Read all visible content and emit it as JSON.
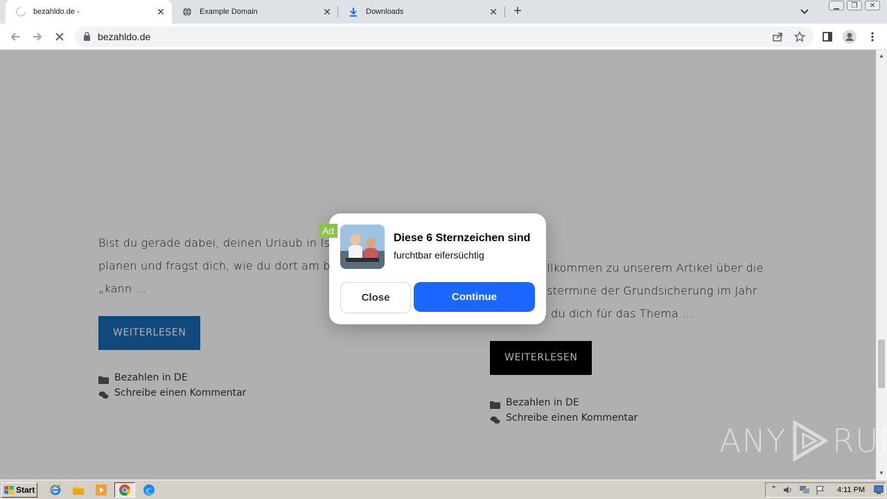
{
  "browser": {
    "tabs": [
      {
        "title": "bezahldo.de -",
        "active": true
      },
      {
        "title": "Example Domain",
        "active": false
      },
      {
        "title": "Downloads",
        "active": false
      }
    ],
    "url": "bezahldo.de"
  },
  "page": {
    "left_post": {
      "excerpt_lines": [
        "Bist du gerade dabei, deinen Urlaub in Islan",
        "planen und fragst dich, wie du dort am bes",
        "„kann …"
      ],
      "button": "WEITERLESEN",
      "category": "Bezahlen in DE",
      "comment": "Schreibe einen Kommentar"
    },
    "right_post": {
      "excerpt_lines": [
        "Willkommen zu unserem Artikel über die",
        "ngstermine der Grundsicherung im Jahr",
        "nn du dich für das Thema …"
      ],
      "button": "WEITERLESEN",
      "category": "Bezahlen in DE",
      "comment": "Schreibe einen Kommentar"
    }
  },
  "ad_modal": {
    "badge": "Ad",
    "title": "Diese 6 Sternzeichen sind",
    "subtitle": "furchtbar eifersüchtig",
    "close_label": "Close",
    "continue_label": "Continue"
  },
  "watermark": {
    "left": "ANY",
    "right": "RUN"
  },
  "taskbar": {
    "start_label": "Start",
    "time": "4:11 PM"
  },
  "colors": {
    "left_button": "#1a6bb5",
    "right_button": "#000000",
    "continue_button": "#1a66ff",
    "ad_badge": "#8bc34a"
  }
}
